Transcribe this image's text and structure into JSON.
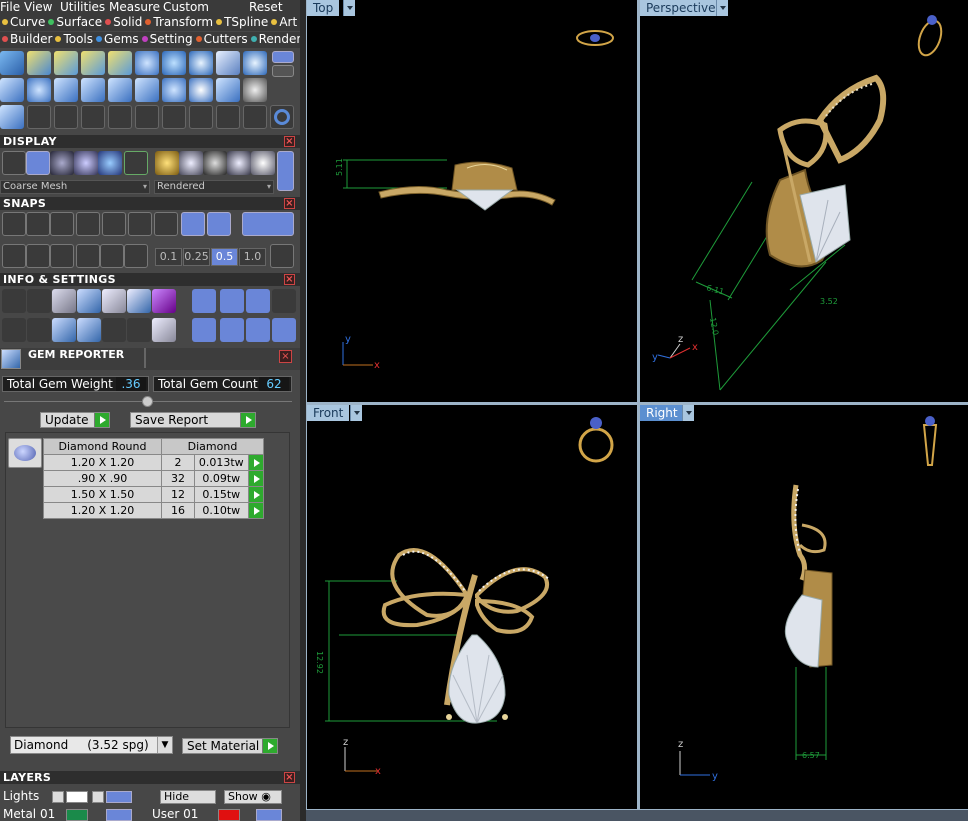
{
  "menu": [
    "File",
    "View",
    "Utilities",
    "Measure",
    "Custom",
    "Reset"
  ],
  "modules_row1": [
    {
      "label": "Curve",
      "color": "#e8c040"
    },
    {
      "label": "Surface",
      "color": "#40c060"
    },
    {
      "label": "Solid",
      "color": "#e05050"
    },
    {
      "label": "Transform",
      "color": "#e06030"
    },
    {
      "label": "TSpline",
      "color": "#e8c040"
    },
    {
      "label": "Art",
      "color": "#e8c040"
    }
  ],
  "modules_row2": [
    {
      "label": "Builder",
      "color": "#e05050"
    },
    {
      "label": "Tools",
      "color": "#e8c040"
    },
    {
      "label": "Gems",
      "color": "#4090e0"
    },
    {
      "label": "Setting",
      "color": "#c040c0"
    },
    {
      "label": "Cutters",
      "color": "#e06030"
    },
    {
      "label": "Render",
      "color": "#40b0b0"
    }
  ],
  "sections": {
    "display": "DISPLAY",
    "snaps": "SNAPS",
    "info": "INFO & SETTINGS",
    "gem_reporter": "GEM REPORTER",
    "layers": "LAYERS"
  },
  "display": {
    "mesh": "Coarse Mesh",
    "render_mode": "Rendered"
  },
  "snaps": {
    "values": [
      "0.1",
      "0.25",
      "0.5",
      "1.0"
    ],
    "active": "0.5"
  },
  "gem_reporter": {
    "total_weight_label": "Total Gem Weight",
    "total_weight": ".36",
    "total_count_label": "Total Gem Count",
    "total_count": "62",
    "update_label": "Update",
    "save_label": "Save Report",
    "headers": [
      "Diamond Round",
      "Diamond"
    ],
    "rows": [
      {
        "size": "1.20 X 1.20",
        "count": "2",
        "weight": "0.013tw"
      },
      {
        "size": ".90 X .90",
        "count": "32",
        "weight": "0.09tw"
      },
      {
        "size": "1.50 X 1.50",
        "count": "12",
        "weight": "0.15tw"
      },
      {
        "size": "1.20 X 1.20",
        "count": "16",
        "weight": "0.10tw"
      }
    ],
    "material": "Diamond     (3.52 spg)",
    "set_material_label": "Set Material"
  },
  "layers": {
    "lights_label": "Lights",
    "hide_label": "Hide",
    "show_label": "Show",
    "row2_a": "Metal 01",
    "row2_b": "User 01"
  },
  "viewports": {
    "top": {
      "label": "Top",
      "dim": "5.11",
      "axes": [
        "y",
        "x"
      ]
    },
    "perspective": {
      "label": "Perspective",
      "dims": [
        "6.11",
        "12.0",
        "3.52"
      ],
      "axes": [
        "z",
        "y",
        "x"
      ]
    },
    "front": {
      "label": "Front",
      "dim": "12.92",
      "axes": [
        "z",
        "x"
      ]
    },
    "right": {
      "label": "Right",
      "dim": "6.57",
      "axes": [
        "z",
        "y"
      ]
    }
  },
  "colors": {
    "metal": "#c9a866",
    "gem": "#dfe4ec",
    "dim_line": "#1e9c3a",
    "axis_x": "#e03030",
    "axis_y": "#3070e0",
    "axis_z": "#d0d0d0",
    "active_view": "#5b8fd0"
  }
}
